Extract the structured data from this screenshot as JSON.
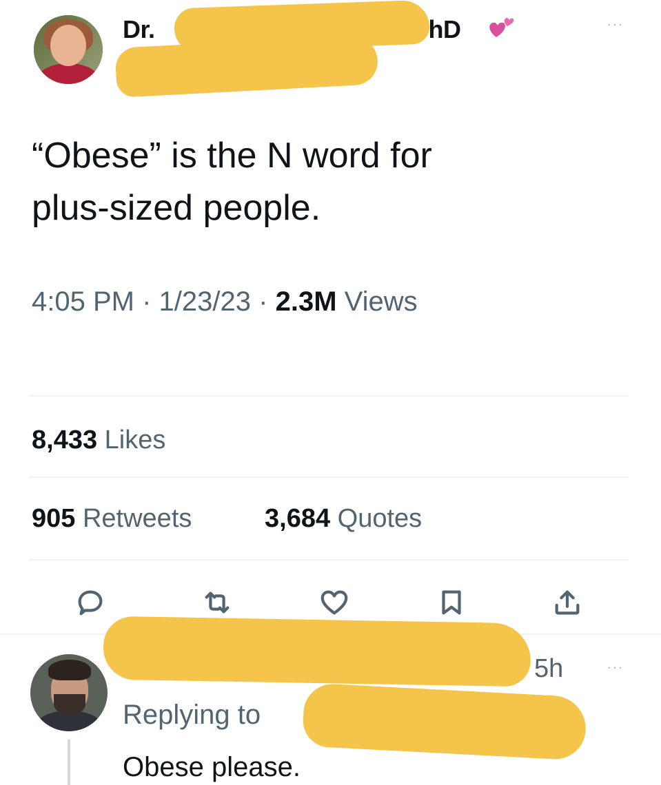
{
  "tweet": {
    "author_name_prefix": "Dr.",
    "author_name_suffix": "PhD",
    "text": "“Obese” is the N word for\nplus-sized people.",
    "time": "4:05 PM",
    "separator": "·",
    "date": "1/23/23",
    "views_count": "2.3M",
    "views_label": "Views",
    "likes_count": "8,433",
    "likes_label": "Likes",
    "retweets_count": "905",
    "retweets_label": "Retweets",
    "quotes_count": "3,684",
    "quotes_label": "Quotes",
    "more_icon": "···"
  },
  "actions": [
    {
      "name": "reply",
      "icon": "comment-icon"
    },
    {
      "name": "retweet",
      "icon": "retweet-icon"
    },
    {
      "name": "like",
      "icon": "heart-outline-icon"
    },
    {
      "name": "bookmark",
      "icon": "bookmark-icon"
    },
    {
      "name": "share",
      "icon": "share-icon"
    }
  ],
  "reply": {
    "time": "5h",
    "replying_to_label": "Replying to",
    "text": "Obese please.",
    "more_icon": "···"
  },
  "colors": {
    "primary_text": "#0f1419",
    "secondary_text": "#536471",
    "divider": "#eff3f4",
    "redaction": "#f4c54a",
    "heart_emoji": "#e0529c"
  }
}
